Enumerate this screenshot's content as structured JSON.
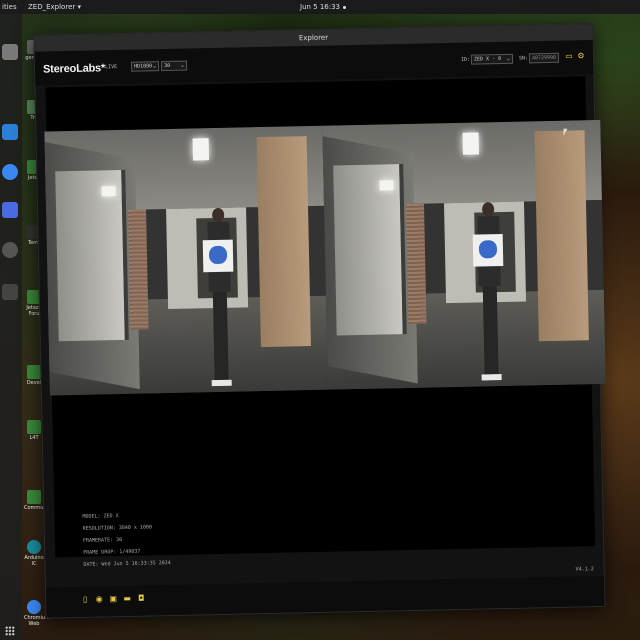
{
  "desktop": {
    "topbar": {
      "activities_label": "ities",
      "app_menu_label": "ZED_Explorer ▾",
      "clock": "Jun 5 16:33"
    },
    "dock_items": [
      {
        "name": "files-icon",
        "color": "#7a7a7a"
      },
      {
        "name": "vscode-icon",
        "color": "#2b7fd4"
      },
      {
        "name": "chromium-icon",
        "color": "#3b86f0"
      },
      {
        "name": "screenshot-icon",
        "color": "#4a6ae0"
      },
      {
        "name": "obs-icon",
        "color": "#555555"
      },
      {
        "name": "terminal-icon",
        "color": "#444444"
      }
    ],
    "desktop_icons": [
      {
        "label": "genbot",
        "color": "#6a6a6a"
      },
      {
        "label": "Tro",
        "color": "#5a8a5a"
      },
      {
        "label": "Jetso",
        "color": "#3a8a3a"
      },
      {
        "label": "Term",
        "color": "#333333"
      },
      {
        "label": "Jetson Foru",
        "color": "#3a8a3a"
      },
      {
        "label": "Devel",
        "color": "#3a8a3a"
      },
      {
        "label": "L4T",
        "color": "#3a8a3a"
      },
      {
        "label": "Community",
        "color": "#3a8a3a"
      },
      {
        "label": "Arduino IC",
        "color": "#1a8a9a"
      },
      {
        "label": "Chromium Web",
        "color": "#3b86f0"
      }
    ]
  },
  "window": {
    "title": "Explorer",
    "brand": "StereoLabs*",
    "mode_label": "LIVE",
    "resolution_select": "HD1080",
    "fps_select": "30",
    "id_label": "ID:",
    "id_select": "ZED X - 0",
    "sn_label": "SN:",
    "sn_value": "40729990",
    "info": {
      "model": "MODEL: ZED X",
      "resolution": "RESOLUTION: 3840 x 1080",
      "framerate": "FRAMERATE: 30",
      "frame_drop": "FRAME DROP: 1/49037",
      "date": "DATE: Wed Jun 5 16:33:35 2024"
    },
    "version": "V4.1.2"
  },
  "accent_color": "#e5c84a"
}
